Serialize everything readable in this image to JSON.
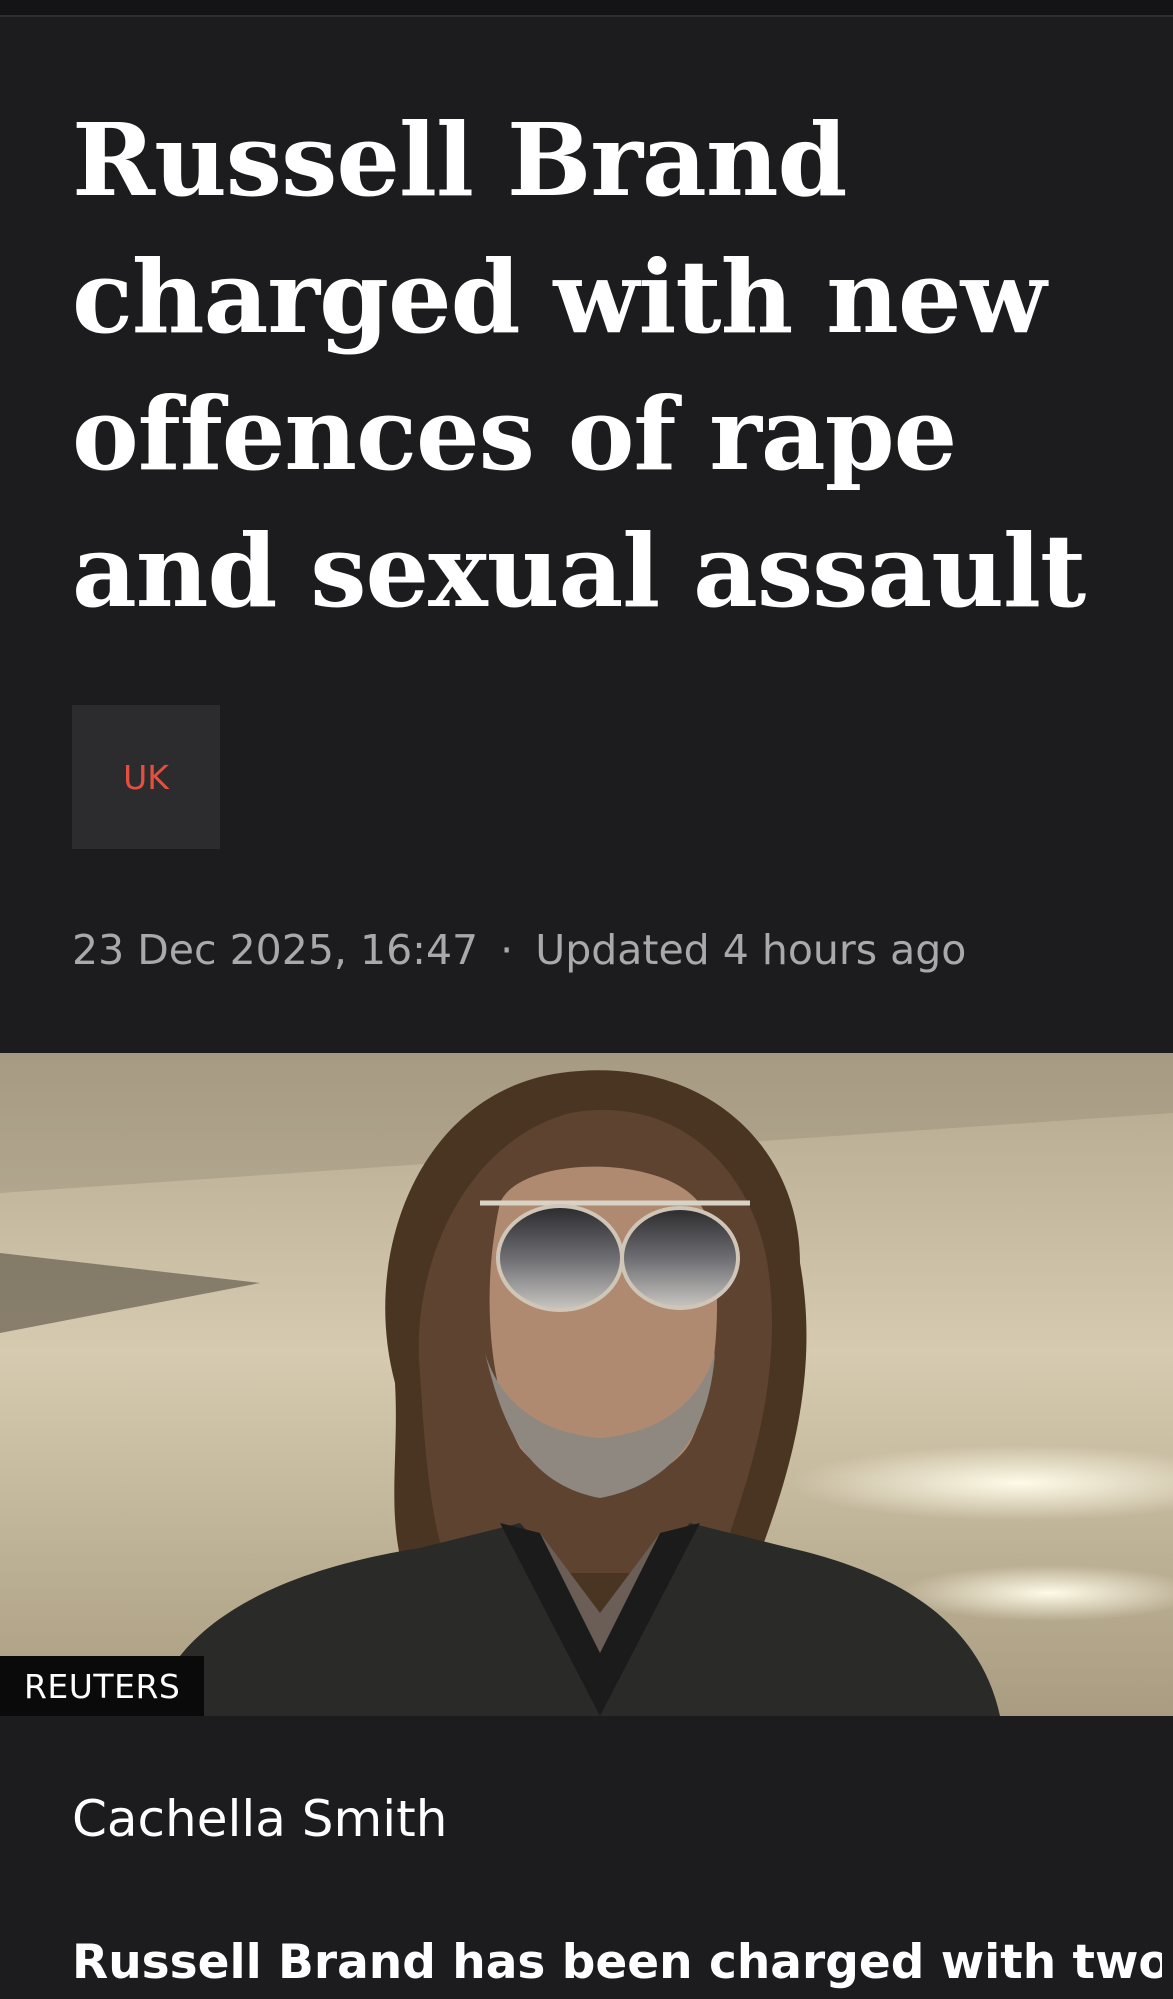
{
  "article": {
    "headline": "Russell Brand charged with new offences of rape and sexual assault",
    "topic_tag": "UK",
    "published": "23 Dec 2025, 16:47",
    "separator": "·",
    "updated": "Updated 4 hours ago",
    "image": {
      "credit": "REUTERS",
      "subject": "man-with-long-curly-hair-and-aviator-sunglasses"
    },
    "byline": "Cachella Smith",
    "lede": "Russell Brand has been charged with two"
  },
  "colors": {
    "background": "#1c1c1e",
    "text": "#ffffff",
    "meta_text": "#a8a8ad",
    "tag_background": "#2c2c2e",
    "tag_text": "#e4503f",
    "credit_background": "#0a0a0a"
  }
}
